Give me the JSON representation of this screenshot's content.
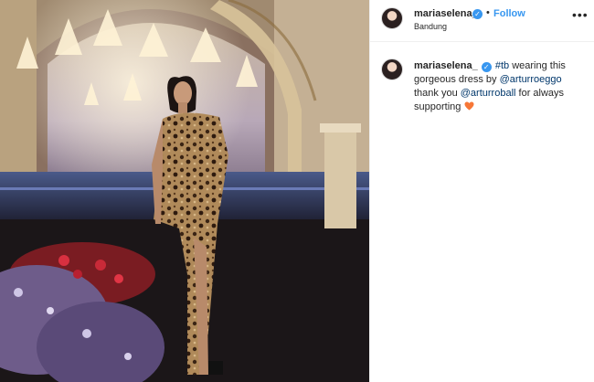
{
  "post": {
    "username": "mariaselena_",
    "dot": "•",
    "follow_label": "Follow",
    "location": "Bandung",
    "more_label": "•••",
    "verified_mark": "✓"
  },
  "caption": {
    "username": "mariaselena_",
    "hashtag": "#tb",
    "text_1": " wearing this gorgeous dress by ",
    "mention_1": "@arturroeggo",
    "text_2": " thank you ",
    "mention_2": "@arturroball",
    "text_3": " for always supporting ",
    "emoji_color": "#f77737"
  },
  "colors": {
    "accent_blue": "#3897f0",
    "link_navy": "#00376b",
    "border": "#efefef"
  }
}
